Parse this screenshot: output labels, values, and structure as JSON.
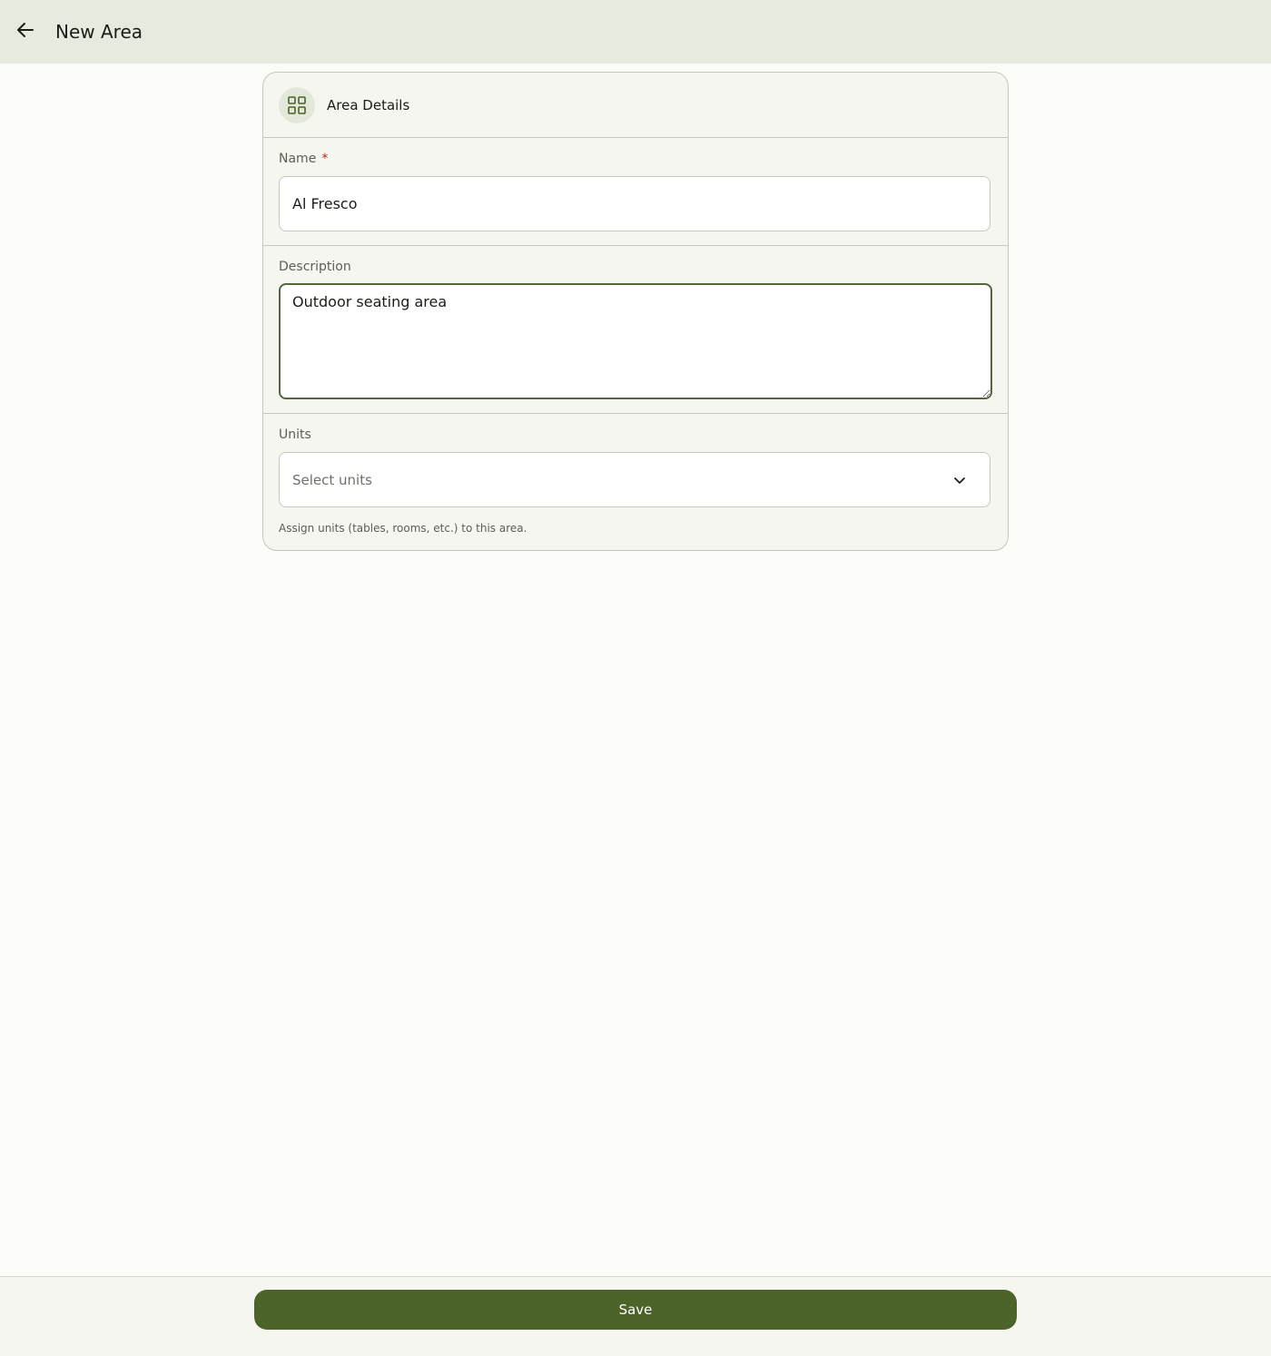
{
  "header": {
    "title": "New Area",
    "back_icon": "arrow-left-icon"
  },
  "card": {
    "icon": "grid-icon",
    "title": "Area Details"
  },
  "form": {
    "name": {
      "label": "Name",
      "required_mark": "*",
      "value": "Al Fresco"
    },
    "description": {
      "label": "Description",
      "value": "Outdoor seating area"
    },
    "units": {
      "label": "Units",
      "placeholder": "Select units",
      "helper": "Assign units (tables, rooms, etc.) to this area.",
      "chevron_icon": "chevron-down-icon"
    }
  },
  "footer": {
    "save_label": "Save"
  },
  "colors": {
    "primary": "#4c632a",
    "focus_border": "#55663b",
    "topbar_bg": "#e6ebe0",
    "required": "#b3261e"
  }
}
